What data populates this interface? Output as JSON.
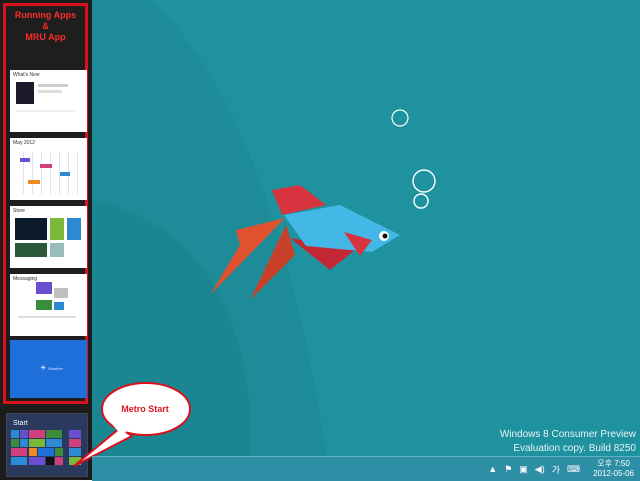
{
  "switcher": {
    "title_line1": "Running Apps",
    "title_line2": "&",
    "title_line3": "MRU App",
    "thumbs": [
      {
        "caption": "What's New"
      },
      {
        "caption": "May 2012"
      },
      {
        "caption": "Store"
      },
      {
        "caption": "Messaging"
      },
      {
        "caption": "Weather"
      }
    ],
    "start_label": "Start"
  },
  "callout": {
    "text": "Metro Start"
  },
  "watermark": {
    "line1": "Windows 8 Consumer Preview",
    "line2": "Evaluation copy. Build 8250"
  },
  "taskbar": {
    "tray_icons": [
      "show-hidden-icon",
      "flag-icon",
      "network-icon",
      "volume-icon",
      "ime-icon",
      "keyboard-icon"
    ],
    "ime_text": "가",
    "time": "오후 7:50",
    "date": "2012-05-06"
  }
}
